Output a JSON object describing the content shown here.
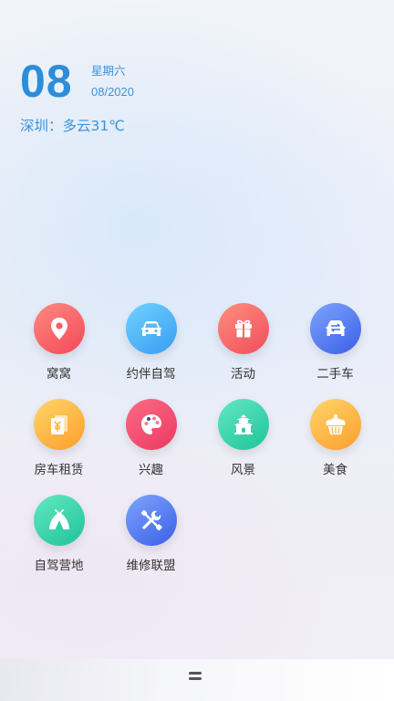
{
  "date": {
    "day": "08",
    "weekday": "星期六",
    "month_year": "08/2020"
  },
  "weather": {
    "text": "深圳：多云31℃"
  },
  "apps": [
    {
      "label": "窝窝",
      "icon": "location-pin-icon",
      "colors": [
        "#ff8a7f",
        "#f4485a"
      ]
    },
    {
      "label": "约伴自驾",
      "icon": "car-icon",
      "colors": [
        "#6fd3ff",
        "#3a9bf2"
      ]
    },
    {
      "label": "活动",
      "icon": "gift-icon",
      "colors": [
        "#ff8f7f",
        "#f04c5b"
      ]
    },
    {
      "label": "二手车",
      "icon": "car-exchange-icon",
      "colors": [
        "#7ea4ff",
        "#3a5fe6"
      ]
    },
    {
      "label": "房车租赁",
      "icon": "yuan-document-icon",
      "colors": [
        "#ffd56a",
        "#fc9e2c"
      ]
    },
    {
      "label": "兴趣",
      "icon": "palette-icon",
      "colors": [
        "#ff6a86",
        "#e93a62"
      ]
    },
    {
      "label": "风景",
      "icon": "pavilion-icon",
      "colors": [
        "#63e8c0",
        "#1fc39b"
      ]
    },
    {
      "label": "美食",
      "icon": "cupcake-icon",
      "colors": [
        "#ffd56a",
        "#fc9e2c"
      ]
    },
    {
      "label": "自驾营地",
      "icon": "tent-icon",
      "colors": [
        "#63e8c0",
        "#1fc39b"
      ]
    },
    {
      "label": "维修联盟",
      "icon": "tools-icon",
      "colors": [
        "#7ea4ff",
        "#3a5fe6"
      ]
    }
  ]
}
